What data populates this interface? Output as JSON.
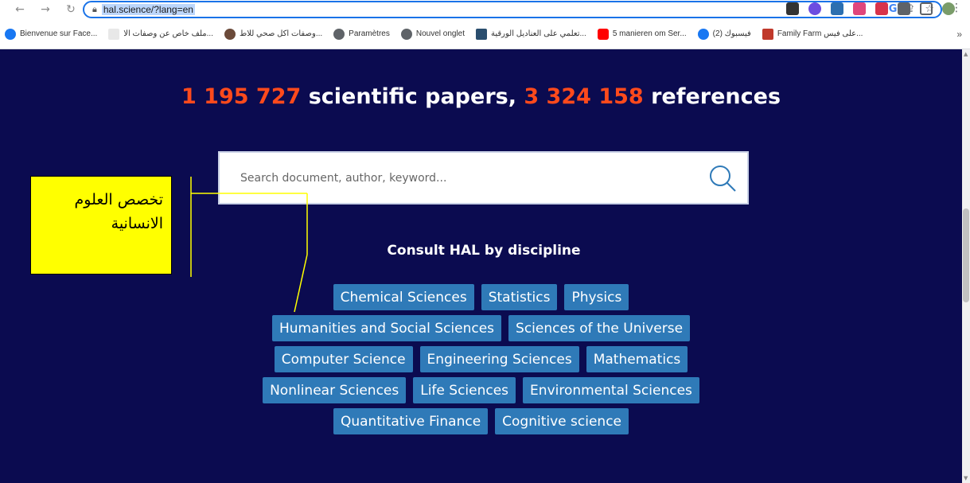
{
  "browser": {
    "url": "hal.science/?lang=en",
    "bookmarks": [
      {
        "label": "Bienvenue sur Face...",
        "color": "#1877f2"
      },
      {
        "label": "ملف خاص عن وصفات الا...",
        "color": "#e8e8e8"
      },
      {
        "label": "وصفات اكل صحي للاط...",
        "color": "#6b4a3a"
      },
      {
        "label": "Paramètres",
        "color": "#5f6368"
      },
      {
        "label": "Nouvel onglet",
        "color": "#5f6368"
      },
      {
        "label": "تعلمي على العناديل الورقية...",
        "color": "#2a4e6e"
      },
      {
        "label": "5 manieren om Ser...",
        "color": "#ff0000"
      },
      {
        "label": "(2) فيسبوك",
        "color": "#1877f2"
      },
      {
        "label": "Family Farm على فيس...",
        "color": "#c0392b"
      }
    ],
    "more_label": "»"
  },
  "headline": {
    "papers_count": "1 195 727",
    "papers_label": " scientific papers, ",
    "refs_count": "3 324 158",
    "refs_label": " references"
  },
  "search": {
    "placeholder": "Search document, author, keyword..."
  },
  "consult_title": "Consult HAL by discipline",
  "disciplines": [
    [
      "Chemical Sciences",
      "Statistics",
      "Physics"
    ],
    [
      "Humanities and Social Sciences",
      "Sciences of the Universe"
    ],
    [
      "Computer Science",
      "Engineering Sciences",
      "Mathematics"
    ],
    [
      "Nonlinear Sciences",
      "Life Sciences",
      "Environmental Sciences"
    ],
    [
      "Quantitative Finance",
      "Cognitive science"
    ]
  ],
  "annotation": {
    "text_line1": "تخصص العلوم",
    "text_line2": "الانسانية",
    "color": "#ffff00"
  },
  "colors": {
    "page_bg": "#0b0b50",
    "accent_number": "#ff4a1c",
    "chip_bg": "#2f7ab8"
  }
}
